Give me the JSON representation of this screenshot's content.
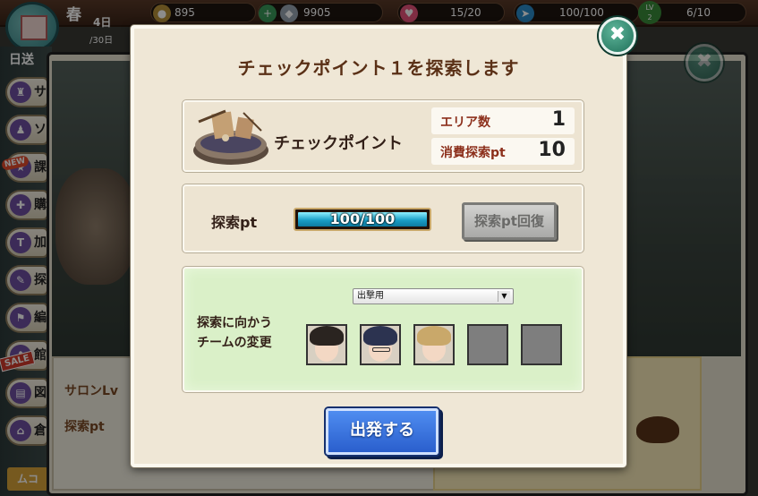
{
  "hud": {
    "season": "春",
    "day": "4日",
    "day_total": "/30日",
    "coins": "895",
    "plus_icon": "+",
    "gems": "9905",
    "hearts": "15/20",
    "stamina": "100/100",
    "level_badge_top": "LV",
    "level_badge_num": "2",
    "level_progress": "6/10"
  },
  "side_menu": {
    "header": "日送",
    "items": [
      "サ",
      "ソ",
      "課",
      "購",
      "加",
      "探",
      "編",
      "館",
      "図",
      "倉"
    ],
    "new_badge": "NEW",
    "sale_badge": "SALE",
    "bottom_tab": "ムコ"
  },
  "background_panel": {
    "salon_label": "サロンLv",
    "explore_pt_label": "探索pt"
  },
  "dialog": {
    "title": "チェックポイント１を探索します",
    "checkpoint_name": "チェックポイント",
    "area_count_label": "エリア数",
    "area_count_value": "1",
    "cost_label": "消費探索pt",
    "cost_value": "10",
    "explore_pt_label": "探索pt",
    "explore_pt_value": "100/100",
    "explore_pt_fill": 1.0,
    "recover_button": "探索pt回復",
    "team_select_value": "出撃用",
    "team_select_arrow": "▼",
    "team_label_line1": "探索に向かう",
    "team_label_line2": "チームの変更",
    "depart_button": "出発する",
    "close_icon": "✖"
  },
  "team_slots": [
    {
      "filled": true,
      "hair": "#2a2420"
    },
    {
      "filled": true,
      "hair": "#2c3350"
    },
    {
      "filled": true,
      "hair": "#c9a86a"
    },
    {
      "filled": false
    },
    {
      "filled": false
    }
  ],
  "colors": {
    "title_brown": "#5a3016",
    "stat_label_red": "#8c2f1b",
    "depart_blue": "#2a5fcd",
    "bar_cyan": "#1a9fc7",
    "team_panel_green": "#daf0c8"
  }
}
